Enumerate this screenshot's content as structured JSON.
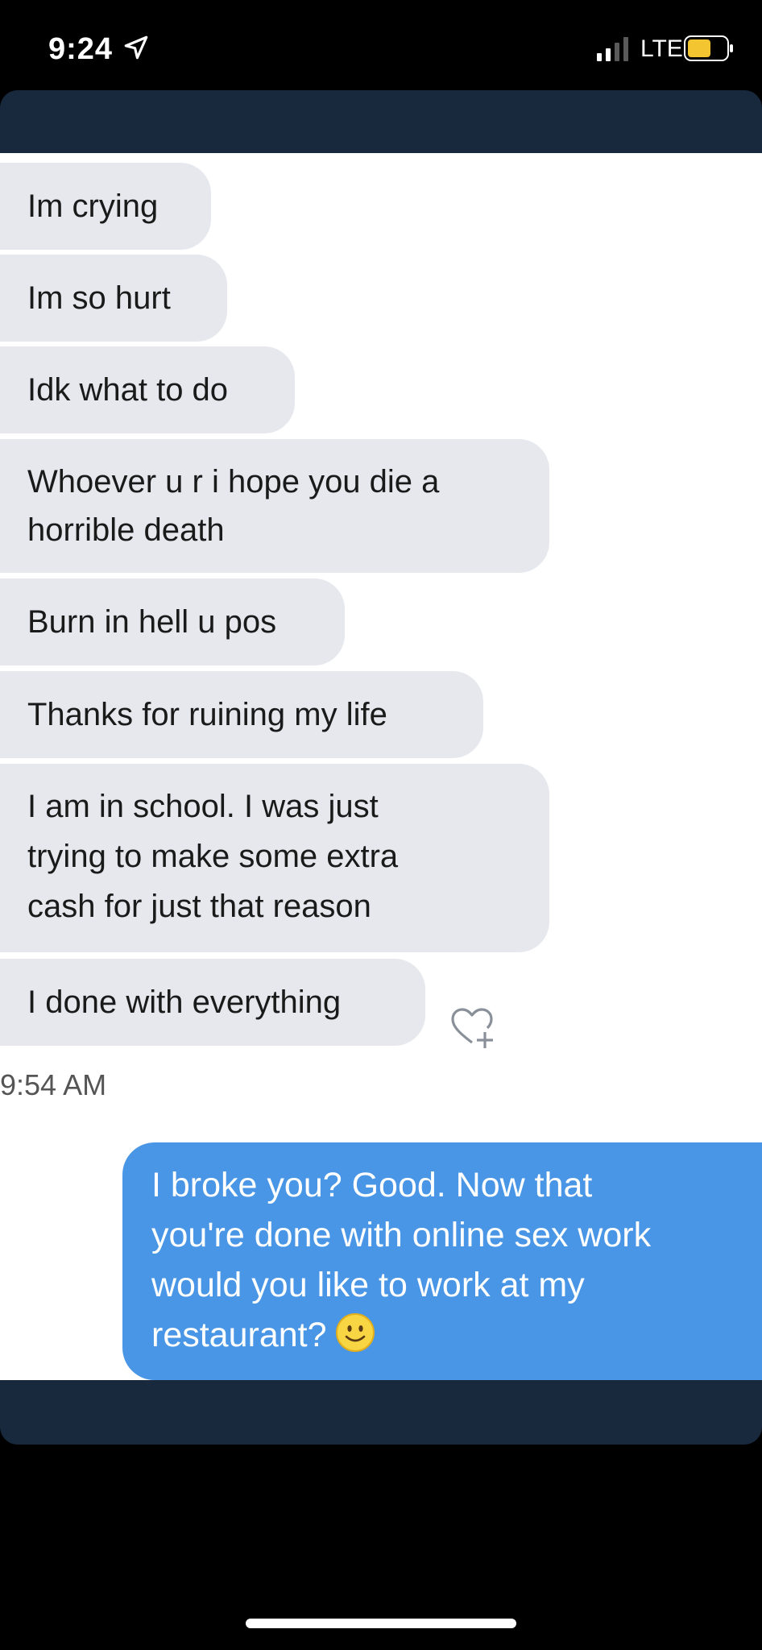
{
  "status_bar": {
    "time": "9:24",
    "network": "LTE",
    "location_icon": "location-arrow-icon",
    "signal_icon": "signal-bars-icon",
    "battery_icon": "battery-icon"
  },
  "messages_received": [
    {
      "lines": [
        "Im crying"
      ]
    },
    {
      "lines": [
        "Im so hurt"
      ]
    },
    {
      "lines": [
        "Idk what to do"
      ]
    },
    {
      "lines": [
        "Whoever u r i hope you die a",
        "horrible death"
      ]
    },
    {
      "lines": [
        "Burn in hell u pos"
      ]
    },
    {
      "lines": [
        "Thanks for ruining my life"
      ]
    },
    {
      "lines": [
        "I am in school. I was just",
        "trying to make some extra",
        "cash for just that reason"
      ]
    },
    {
      "lines": [
        "I done with everything"
      ]
    }
  ],
  "reaction_icon": "heart-add-icon",
  "timestamp": "9:54 AM",
  "message_sent": {
    "lines": [
      "I broke you? Good. Now that",
      "you're done with online sex work",
      "would you like to work at my",
      "restaurant?"
    ],
    "emoji": "slightly-smiling-face"
  },
  "colors": {
    "received_bubble": "#e6e8ee",
    "sent_bubble": "#4a96e6",
    "bars": "#19293d"
  }
}
